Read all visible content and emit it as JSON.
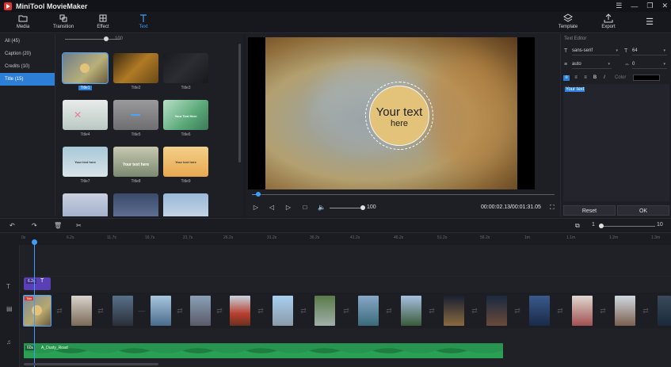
{
  "window": {
    "title": "MiniTool MovieMaker",
    "controls": [
      "☰",
      "—",
      "❐",
      "✕"
    ]
  },
  "toolbar": {
    "media": "Media",
    "transition": "Transition",
    "effect": "Effect",
    "text": "Text",
    "template": "Template",
    "export": "Export",
    "menu": "☰"
  },
  "categories": [
    {
      "label": "All (45)"
    },
    {
      "label": "Caption (20)"
    },
    {
      "label": "Credits (10)"
    },
    {
      "label": "Title (15)"
    }
  ],
  "library": {
    "zoom_value": "100",
    "thumbs": [
      {
        "label": "Title1",
        "text": ""
      },
      {
        "label": "Title2",
        "text": ""
      },
      {
        "label": "Title3",
        "text": ""
      },
      {
        "label": "Title4",
        "text": ""
      },
      {
        "label": "Title5",
        "text": ""
      },
      {
        "label": "Title6",
        "text": "Your Text Here"
      },
      {
        "label": "Title7",
        "text": "Your text here"
      },
      {
        "label": "Title8",
        "text": "Your text here"
      },
      {
        "label": "Title9",
        "text": "Your text here"
      },
      {
        "label": "",
        "text": ""
      },
      {
        "label": "",
        "text": ""
      },
      {
        "label": "",
        "text": ""
      }
    ]
  },
  "preview": {
    "overlay_line1": "Your text",
    "overlay_line2": "here",
    "volume": "100",
    "timecode": "00:00:02.13/00:01:31.05",
    "progress": 0.02
  },
  "editor": {
    "title": "Text Editor",
    "font": "sans-serif",
    "size": "64",
    "line_spacing": "auto",
    "letter_spacing": "0",
    "color_label": "Color",
    "color": "#000000",
    "text": "Your text",
    "reset": "Reset",
    "ok": "OK"
  },
  "timeline": {
    "zoom_min": "1",
    "zoom_max": "10",
    "ruler": [
      "0s",
      "6.2s",
      "11.7s",
      "16.7s",
      "21.7s",
      "26.2s",
      "31.2s",
      "36.2s",
      "41.2s",
      "46.2s",
      "51.2s",
      "56.2s",
      "1m",
      "1.1m",
      "1.2m",
      "1.3m"
    ],
    "text_clip_duration": "6.2s",
    "title_clip_label": "Title",
    "audio_duration": "60s",
    "audio_name": "A_Dusty_Road"
  },
  "colors": {
    "accent": "#3f9df5",
    "selected": "#2b7fd6",
    "text_clip": "#5b3fb4",
    "audio": "#1f7d3f"
  }
}
